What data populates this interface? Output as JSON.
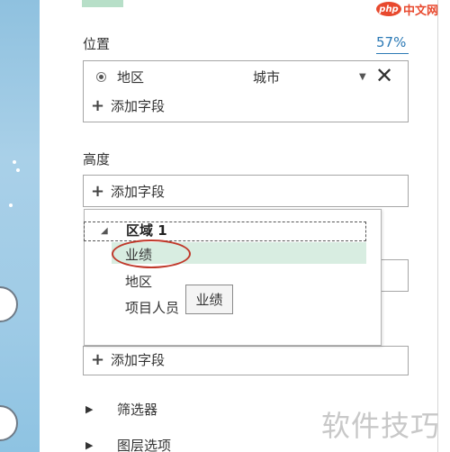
{
  "logo": {
    "badge": "php",
    "text": "中文网"
  },
  "location": {
    "title": "位置",
    "percent": "57%",
    "field_name": "地区",
    "field_type": "城市",
    "add_field": "添加字段"
  },
  "height": {
    "title": "高度",
    "add_field": "添加字段"
  },
  "popup": {
    "group_title": "区域 1",
    "items": [
      "业绩",
      "地区",
      "项目人员"
    ],
    "tooltip": "业绩"
  },
  "category": {
    "add_field": "添加字段"
  },
  "bottom": {
    "filters": "筛选器",
    "layer_options": "图层选项"
  },
  "watermark": "软件技巧"
}
